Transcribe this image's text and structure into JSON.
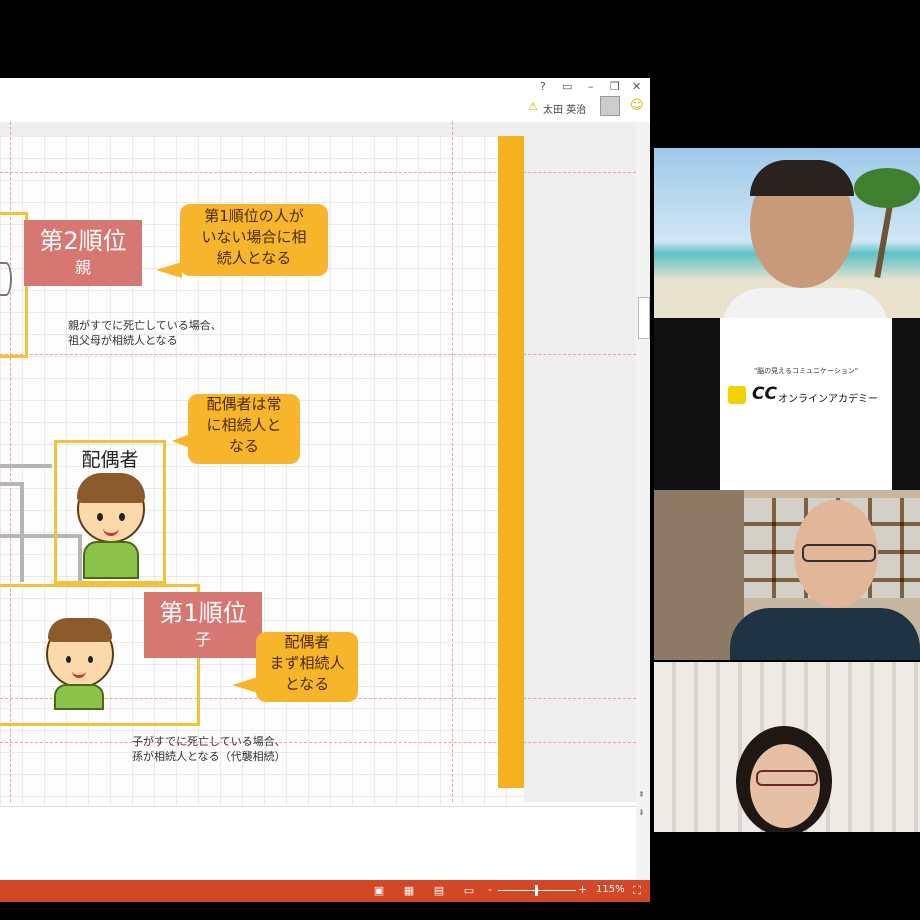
{
  "window": {
    "help_label": "?",
    "user_name": "太田 英治",
    "minimize_label": "–"
  },
  "slide": {
    "rank2": {
      "title": "第2順位",
      "sub": "親"
    },
    "bubble_rank2": "第1順位の人が\nいない場合に相\n続人となる",
    "note_rank2": "親がすでに死亡している場合、\n祖父母が相続人となる",
    "spouse_label": "配偶者",
    "bubble_spouse": "配偶者は常\nに相続人と\nなる",
    "rank1": {
      "title": "第1順位",
      "sub": "子"
    },
    "bubble_rank1": "配偶者\nまず相続人\nとなる",
    "note_rank1": "子がすでに死亡している場合、\n孫が相続人となる（代襲相続）"
  },
  "statusbar": {
    "zoom": "115%",
    "zoom_minus": "-",
    "zoom_plus": "+"
  },
  "logo_tile": {
    "tagline": "\"脳の見えるコミュニケーション\"",
    "brand_mark": "CC",
    "brand_name": "オンラインアカデミー"
  },
  "colors": {
    "accent_orange": "#f5b21f",
    "rank_red": "#d77772",
    "status_bar": "#d24726"
  }
}
